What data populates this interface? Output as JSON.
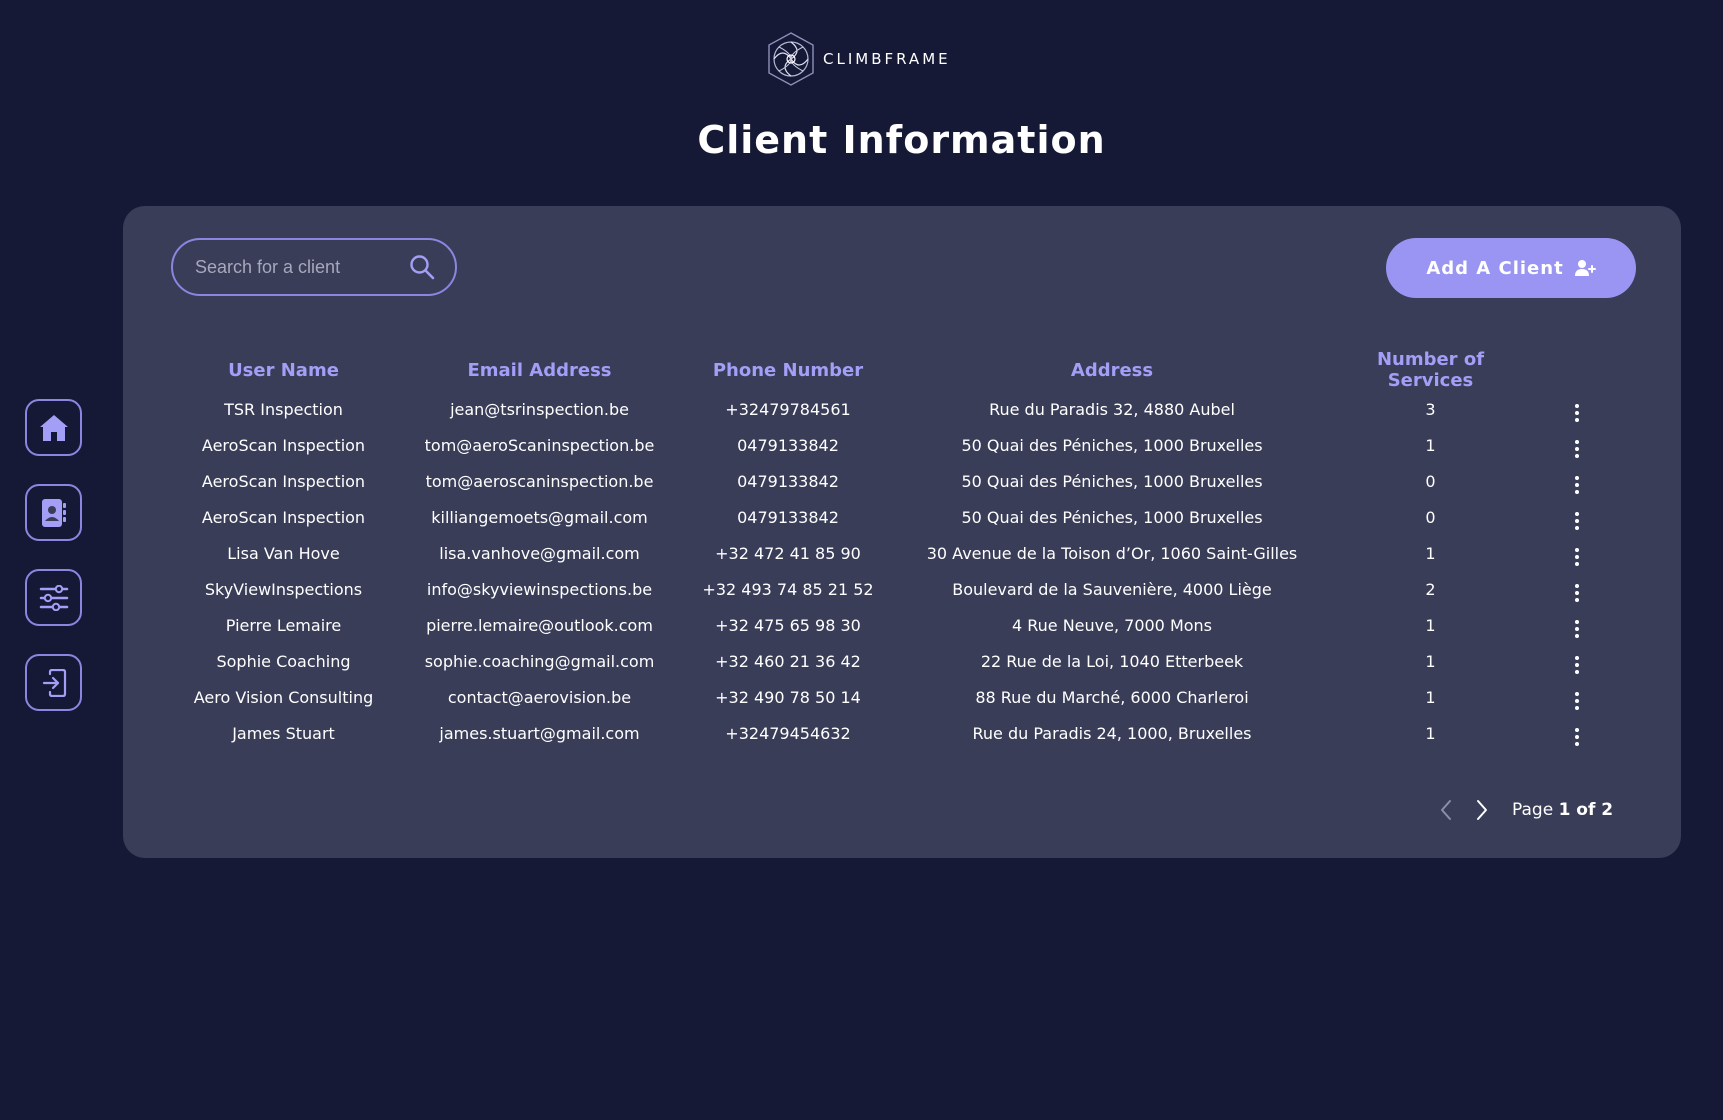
{
  "app": {
    "logo_text": "CLIMBFRAME",
    "page_title": "Client Information"
  },
  "colors": {
    "background": "#151936",
    "panel": "#393d58",
    "accent": "#9a95f2",
    "header_text": "#a39ef6"
  },
  "sidebar": {
    "items": [
      {
        "icon": "home-icon"
      },
      {
        "icon": "contacts-icon"
      },
      {
        "icon": "sliders-icon"
      },
      {
        "icon": "logout-icon"
      }
    ]
  },
  "search": {
    "placeholder": "Search for a client",
    "value": ""
  },
  "add_button": {
    "label": "Add A Client",
    "icon": "add-user-icon"
  },
  "table": {
    "columns": [
      "User Name",
      "Email Address",
      "Phone Number",
      "Address",
      "Number of Services"
    ],
    "rows": [
      {
        "name": "TSR Inspection",
        "email": "jean@tsrinspection.be",
        "phone": "+32479784561",
        "address": "Rue du Paradis 32, 4880 Aubel",
        "services": "3"
      },
      {
        "name": "AeroScan Inspection",
        "email": "tom@aeroScaninspection.be",
        "phone": "0479133842",
        "address": "50 Quai des Péniches, 1000 Bruxelles",
        "services": "1"
      },
      {
        "name": "AeroScan Inspection",
        "email": "tom@aeroscaninspection.be",
        "phone": "0479133842",
        "address": "50 Quai des Péniches, 1000 Bruxelles",
        "services": "0"
      },
      {
        "name": "AeroScan Inspection",
        "email": "killiangemoets@gmail.com",
        "phone": "0479133842",
        "address": "50 Quai des Péniches, 1000 Bruxelles",
        "services": "0"
      },
      {
        "name": "Lisa Van Hove",
        "email": "lisa.vanhove@gmail.com",
        "phone": "+32 472 41 85 90",
        "address": "30 Avenue de la Toison d’Or, 1060 Saint-Gilles",
        "services": "1"
      },
      {
        "name": "SkyViewInspections",
        "email": "info@skyviewinspections.be",
        "phone": "+32 493 74 85 21 52",
        "address": "Boulevard de la Sauvenière, 4000 Liège",
        "services": "2"
      },
      {
        "name": "Pierre Lemaire",
        "email": "pierre.lemaire@outlook.com",
        "phone": "+32 475 65 98 30",
        "address": "4 Rue Neuve, 7000 Mons",
        "services": "1"
      },
      {
        "name": "Sophie Coaching",
        "email": "sophie.coaching@gmail.com",
        "phone": "+32 460 21 36 42",
        "address": "22 Rue de la Loi, 1040 Etterbeek",
        "services": "1"
      },
      {
        "name": "Aero Vision Consulting",
        "email": "contact@aerovision.be",
        "phone": "+32 490 78 50 14",
        "address": "88 Rue du Marché, 6000 Charleroi",
        "services": "1"
      },
      {
        "name": "James Stuart",
        "email": "james.stuart@gmail.com",
        "phone": "+32479454632",
        "address": "Rue du Paradis 24, 1000, Bruxelles",
        "services": "1"
      }
    ]
  },
  "pagination": {
    "prefix": "Page",
    "current": "1 of 2"
  }
}
